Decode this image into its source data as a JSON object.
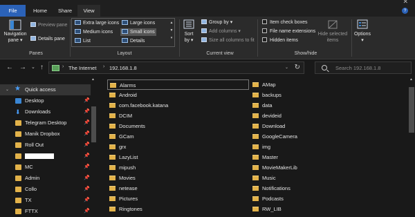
{
  "window": {
    "close_glyph": "✕"
  },
  "tabs": [
    {
      "label": "File"
    },
    {
      "label": "Home"
    },
    {
      "label": "Share"
    },
    {
      "label": "View"
    }
  ],
  "help_glyph": "?",
  "ribbon": {
    "panes": {
      "group_label": "Panes",
      "navigation_pane": [
        "Navigation",
        "pane ▾"
      ],
      "preview_pane": "Preview pane",
      "details_pane": "Details pane"
    },
    "layout": {
      "group_label": "Layout",
      "items": [
        {
          "label": "Extra large icons",
          "selected": false
        },
        {
          "label": "Large icons",
          "selected": false
        },
        {
          "label": "Medium icons",
          "selected": false
        },
        {
          "label": "Small icons",
          "selected": true
        },
        {
          "label": "List",
          "selected": false
        },
        {
          "label": "Details",
          "selected": false
        }
      ]
    },
    "current_view": {
      "group_label": "Current view",
      "sort_by": [
        "Sort",
        "by ▾"
      ],
      "group_by": "Group by ▾",
      "add_columns": "Add columns ▾",
      "size_columns": "Size all columns to fit"
    },
    "show_hide": {
      "group_label": "Show/hide",
      "item_check_boxes": "Item check boxes",
      "file_name_extensions": "File name extensions",
      "hidden_items": "Hidden items",
      "hide_selected": [
        "Hide selected",
        "items"
      ],
      "options": [
        "Options",
        "▾"
      ]
    }
  },
  "nav": {
    "back": "←",
    "forward": "→",
    "recent": "⌄",
    "up": "↑",
    "breadcrumb": [
      "The Internet",
      "192.168.1.8"
    ],
    "search_placeholder": "Search 192.168.1.8"
  },
  "sidebar": {
    "items": [
      {
        "label": "Quick access",
        "icon": "star-icon",
        "pinned": false
      },
      {
        "label": "Desktop",
        "icon": "desktop-icon",
        "pinned": true
      },
      {
        "label": "Downloads",
        "icon": "download-icon",
        "pinned": true
      },
      {
        "label": "Telegram Desktop",
        "icon": "folder-icon",
        "pinned": true
      },
      {
        "label": "Manik Dropbox",
        "icon": "folder-icon",
        "pinned": true
      },
      {
        "label": "Roll Out",
        "icon": "folder-icon",
        "pinned": true
      },
      {
        "label": "",
        "icon": "folder-icon",
        "pinned": true,
        "redacted": true
      },
      {
        "label": "MC",
        "icon": "folder-icon",
        "pinned": true
      },
      {
        "label": "Admin",
        "icon": "folder-icon",
        "pinned": true
      },
      {
        "label": "Collo",
        "icon": "folder-icon",
        "pinned": true
      },
      {
        "label": "TX",
        "icon": "folder-icon",
        "pinned": true
      },
      {
        "label": "FTTX",
        "icon": "folder-icon",
        "pinned": true
      }
    ]
  },
  "folders": {
    "col1": [
      "Alarms",
      "Android",
      "com.facebook.katana",
      "DCIM",
      "Documents",
      "GCam",
      "grx",
      "LazyList",
      "mipush",
      "Movies",
      "netease",
      "Pictures",
      "Ringtones"
    ],
    "col2": [
      "AMap",
      "backups",
      "data",
      "devideid",
      "Download",
      "GoogleCamera",
      "img",
      "Master",
      "MovieMakerLib",
      "Music",
      "Notifications",
      "Podcasts",
      "RW_LIB"
    ]
  },
  "glyphs": {
    "pin": "📌",
    "expand": "›",
    "chevron": "›",
    "dropdown": "⌄",
    "refresh": "↻",
    "scroll_up": "▲"
  }
}
